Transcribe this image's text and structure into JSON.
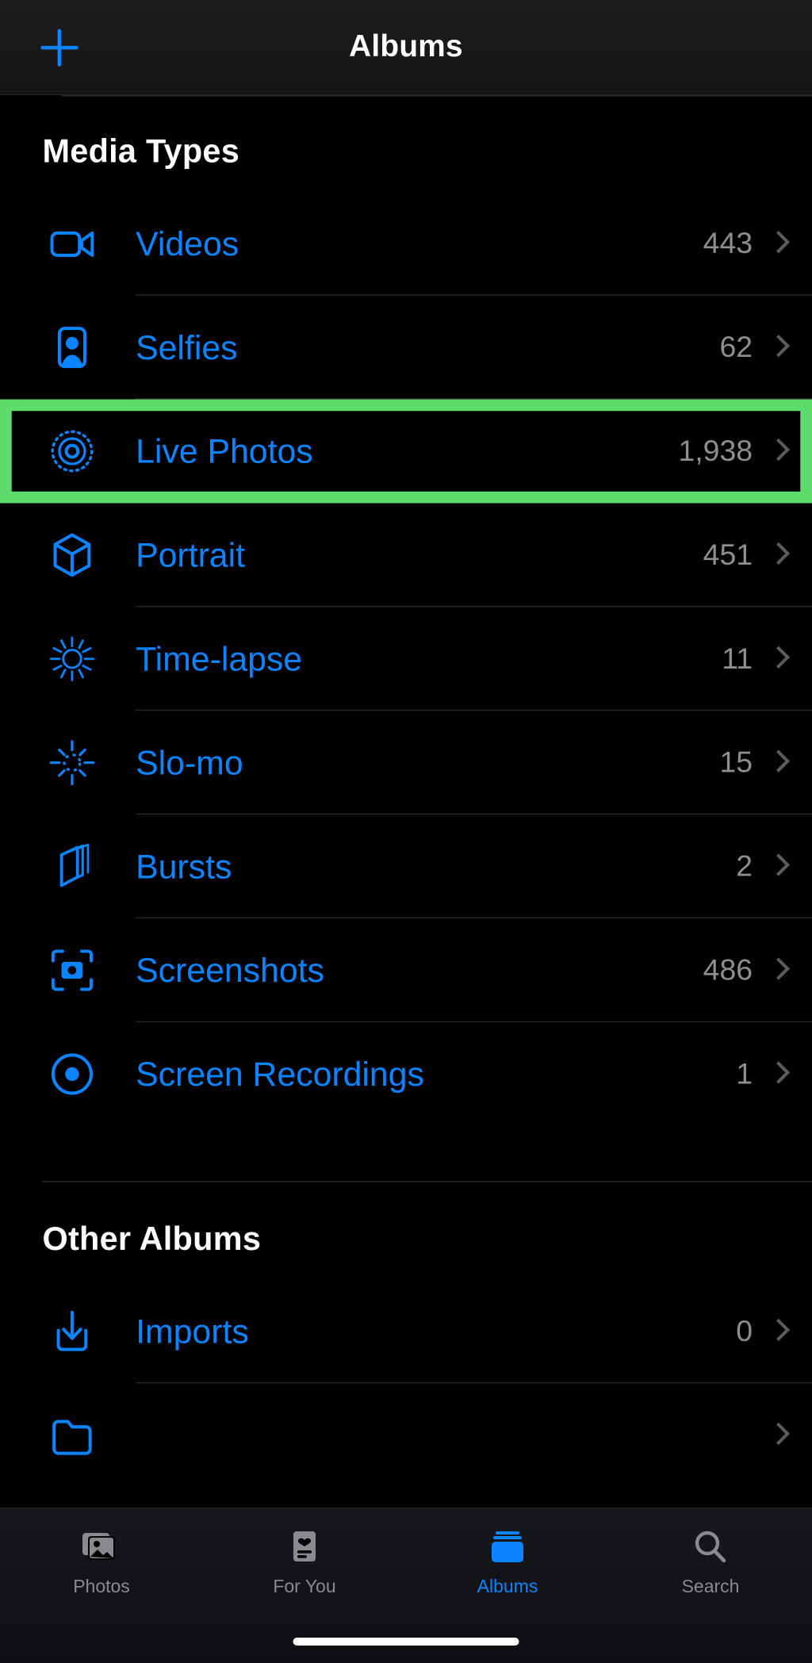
{
  "navbar": {
    "add_icon": "plus-icon",
    "title": "Albums"
  },
  "sections": [
    {
      "title": "Media Types",
      "rows": [
        {
          "icon": "video-camera-icon",
          "label": "Videos",
          "count": "443"
        },
        {
          "icon": "selfie-person-icon",
          "label": "Selfies",
          "count": "62"
        },
        {
          "icon": "live-photo-icon",
          "label": "Live Photos",
          "count": "1,938",
          "highlighted": true
        },
        {
          "icon": "portrait-cube-icon",
          "label": "Portrait",
          "count": "451"
        },
        {
          "icon": "timelapse-icon",
          "label": "Time-lapse",
          "count": "11"
        },
        {
          "icon": "slomo-icon",
          "label": "Slo-mo",
          "count": "15"
        },
        {
          "icon": "bursts-stack-icon",
          "label": "Bursts",
          "count": "2"
        },
        {
          "icon": "screenshot-frame-icon",
          "label": "Screenshots",
          "count": "486"
        },
        {
          "icon": "screen-recording-icon",
          "label": "Screen Recordings",
          "count": "1"
        }
      ]
    },
    {
      "title": "Other Albums",
      "rows": [
        {
          "icon": "imports-tray-arrow-icon",
          "label": "Imports",
          "count": "0"
        }
      ]
    }
  ],
  "tabbar": {
    "tabs": [
      {
        "icon": "photos-stack-icon",
        "label": "Photos",
        "active": false
      },
      {
        "icon": "for-you-card-icon",
        "label": "For You",
        "active": false
      },
      {
        "icon": "albums-folder-icon",
        "label": "Albums",
        "active": true
      },
      {
        "icon": "search-icon",
        "label": "Search",
        "active": false
      }
    ]
  },
  "colors": {
    "accent": "#0a84ff",
    "highlight": "#5ddb6d",
    "secondary_text": "#8e8e93",
    "background": "#000000"
  }
}
